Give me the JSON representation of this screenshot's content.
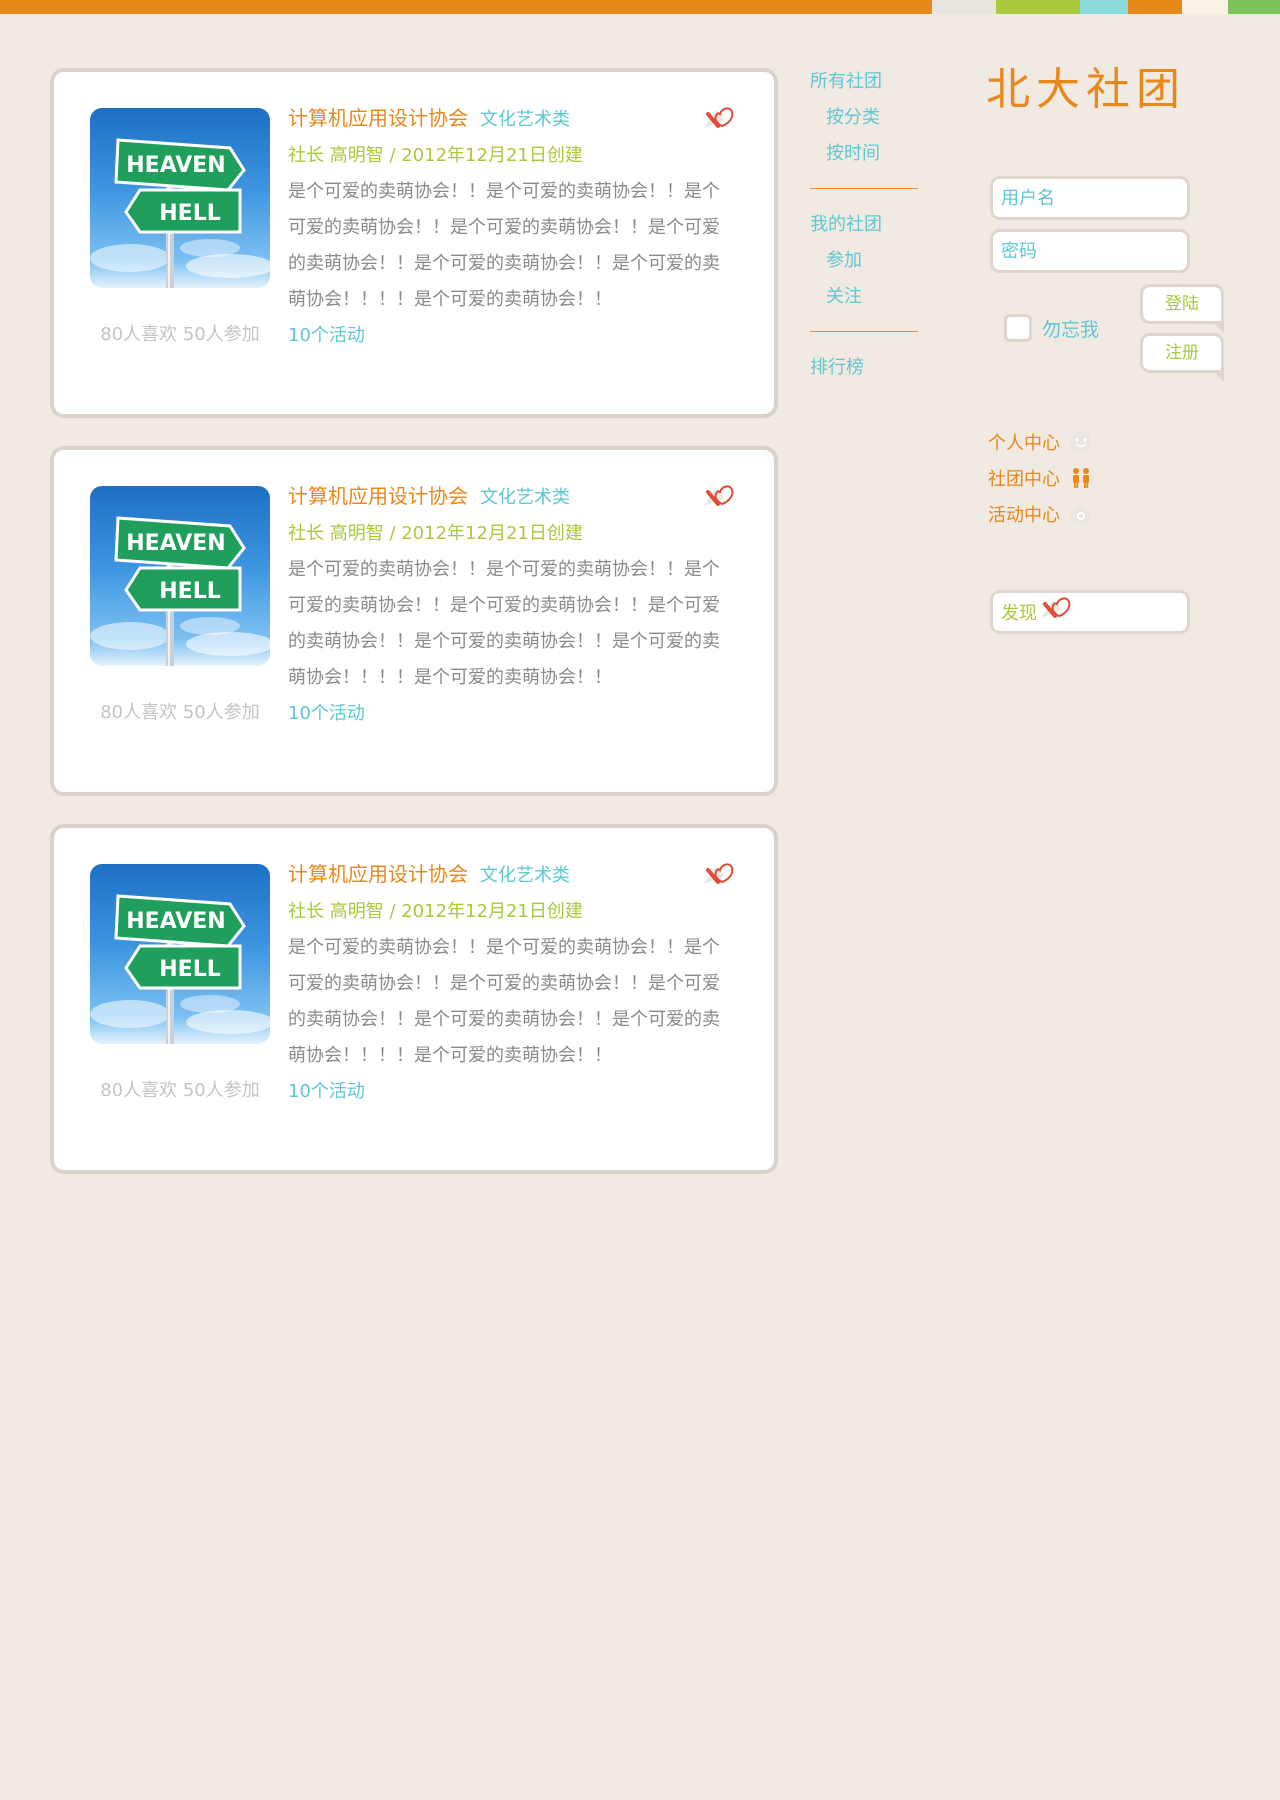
{
  "top_strip": {
    "colors": [
      "#e8881b",
      "#e8881b",
      "#f0eae2",
      "#e8e4de",
      "#a8c93c",
      "#8ad8d8",
      "#e8881b",
      "#f8f2e6",
      "#7cc45a"
    ]
  },
  "colors": {
    "accent_orange": "#e8881b",
    "accent_teal": "#5ec7d2",
    "accent_green": "#a8c93c",
    "text_gray": "#8a8a8a",
    "like_red": "#e24a3a"
  },
  "cards": [
    {
      "club_name": "计算机应用设计协会",
      "category": "文化艺术类",
      "meta": "社长 高明智 / 2012年12月21日创建",
      "description": "是个可爱的卖萌协会！！是个可爱的卖萌协会！！是个可爱的卖萌协会！！是个可爱的卖萌协会！！是个可爱的卖萌协会！！是个可爱的卖萌协会！！是个可爱的卖萌协会！！！！是个可爱的卖萌协会！！",
      "activities": "10个活动",
      "stats": "80人喜欢 50人参加",
      "image_signs": [
        "HEAVEN",
        "HELL"
      ]
    },
    {
      "club_name": "计算机应用设计协会",
      "category": "文化艺术类",
      "meta": "社长 高明智 / 2012年12月21日创建",
      "description": "是个可爱的卖萌协会！！是个可爱的卖萌协会！！是个可爱的卖萌协会！！是个可爱的卖萌协会！！是个可爱的卖萌协会！！是个可爱的卖萌协会！！是个可爱的卖萌协会！！！！是个可爱的卖萌协会！！",
      "activities": "10个活动",
      "stats": "80人喜欢 50人参加",
      "image_signs": [
        "HEAVEN",
        "HELL"
      ]
    },
    {
      "club_name": "计算机应用设计协会",
      "category": "文化艺术类",
      "meta": "社长 高明智 / 2012年12月21日创建",
      "description": "是个可爱的卖萌协会！！是个可爱的卖萌协会！！是个可爱的卖萌协会！！是个可爱的卖萌协会！！是个可爱的卖萌协会！！是个可爱的卖萌协会！！是个可爱的卖萌协会！！！！是个可爱的卖萌协会！！",
      "activities": "10个活动",
      "stats": "80人喜欢 50人参加",
      "image_signs": [
        "HEAVEN",
        "HELL"
      ]
    }
  ],
  "nav": {
    "all_clubs": "所有社团",
    "by_category": "按分类",
    "by_time": "按时间",
    "my_clubs": "我的社团",
    "joined": "参加",
    "followed": "关注",
    "ranking": "排行榜"
  },
  "logo": {
    "text": "北大社团"
  },
  "login": {
    "username_placeholder": "用户名",
    "password_placeholder": "密码",
    "remember_label": "勿忘我",
    "login_button": "登陆",
    "register_button": "注册"
  },
  "centers": [
    {
      "label": "个人中心",
      "icon": "smiley-icon"
    },
    {
      "label": "社团中心",
      "icon": "people-icon"
    },
    {
      "label": "活动中心",
      "icon": "camera-icon"
    }
  ],
  "discover": {
    "label": "发现",
    "icon": "heart-pin-icon"
  }
}
